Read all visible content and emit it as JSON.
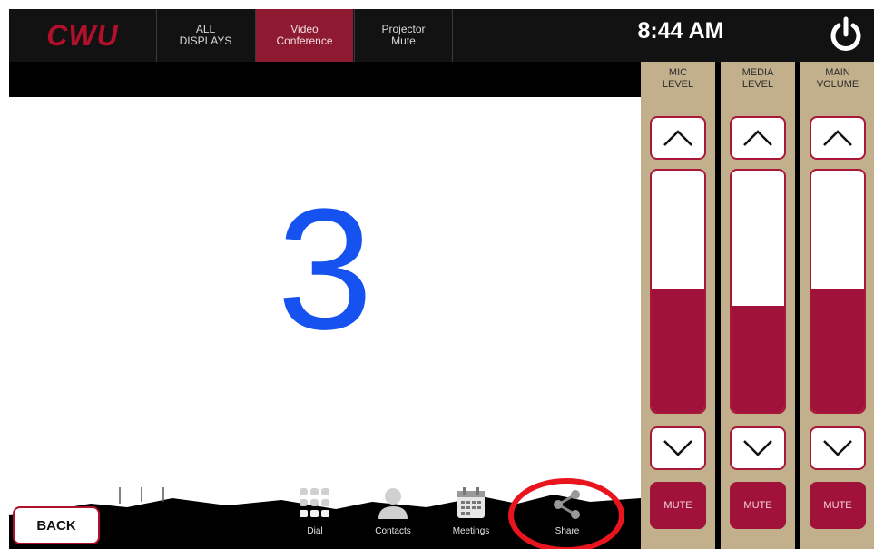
{
  "app": {
    "logo": "CWU"
  },
  "nav": {
    "tabs": [
      {
        "label": "ALL\nDISPLAYS",
        "active": false
      },
      {
        "label": "Video\nConference",
        "active": true
      },
      {
        "label": "Projector\nMute",
        "active": false
      }
    ]
  },
  "status": {
    "time": "8:44 AM"
  },
  "content": {
    "overlay_number": "3"
  },
  "bottom": {
    "back_label": "BACK",
    "dock": [
      {
        "label": "Dial",
        "icon": "dial-keypad-icon"
      },
      {
        "label": "Contacts",
        "icon": "contacts-icon"
      },
      {
        "label": "Meetings",
        "icon": "calendar-icon"
      },
      {
        "label": "Share",
        "icon": "share-icon"
      }
    ]
  },
  "levels": [
    {
      "label": "MIC\nLEVEL",
      "level_fraction": 0.51,
      "mute_label": "MUTE"
    },
    {
      "label": "MEDIA\nLEVEL",
      "level_fraction": 0.44,
      "mute_label": "MUTE"
    },
    {
      "label": "MAIN\nVOLUME",
      "level_fraction": 0.51,
      "mute_label": "MUTE"
    }
  ],
  "colors": {
    "brand_red": "#b0102a",
    "active_tab": "#8e1a32",
    "level_fill": "#a1123a",
    "panel_tan": "#c2b08c",
    "number_blue": "#1652f0",
    "annotation_red": "#e8151f"
  }
}
